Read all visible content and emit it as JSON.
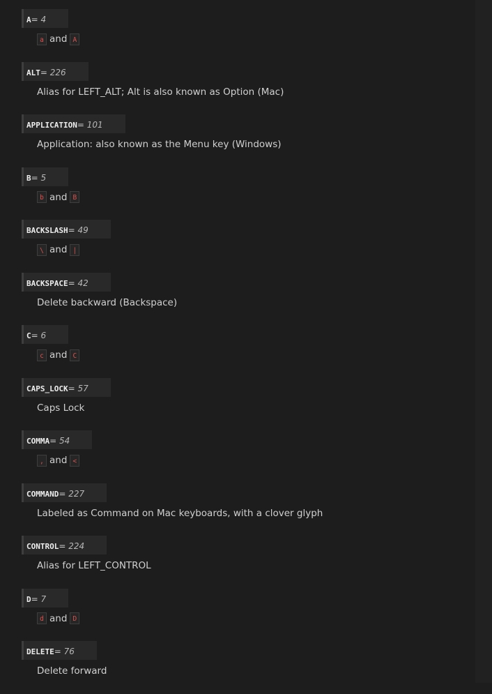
{
  "connector": "and",
  "entries": [
    {
      "name": "A",
      "value": "4",
      "lower": "a",
      "upper": "A"
    },
    {
      "name": "ALT",
      "value": "226",
      "desc": "Alias for LEFT_ALT; Alt is also known as Option (Mac)"
    },
    {
      "name": "APPLICATION",
      "value": "101",
      "desc": "Application: also known as the Menu key (Windows)"
    },
    {
      "name": "B",
      "value": "5",
      "lower": "b",
      "upper": "B"
    },
    {
      "name": "BACKSLASH",
      "value": "49",
      "lower": "\\",
      "upper": "|"
    },
    {
      "name": "BACKSPACE",
      "value": "42",
      "desc": "Delete backward (Backspace)"
    },
    {
      "name": "C",
      "value": "6",
      "lower": "c",
      "upper": "C"
    },
    {
      "name": "CAPS_LOCK",
      "value": "57",
      "desc": "Caps Lock"
    },
    {
      "name": "COMMA",
      "value": "54",
      "lower": ",",
      "upper": "<"
    },
    {
      "name": "COMMAND",
      "value": "227",
      "desc": "Labeled as Command on Mac keyboards, with a clover glyph"
    },
    {
      "name": "CONTROL",
      "value": "224",
      "desc": "Alias for LEFT_CONTROL"
    },
    {
      "name": "D",
      "value": "7",
      "lower": "d",
      "upper": "D"
    },
    {
      "name": "DELETE",
      "value": "76",
      "desc": "Delete forward"
    }
  ]
}
